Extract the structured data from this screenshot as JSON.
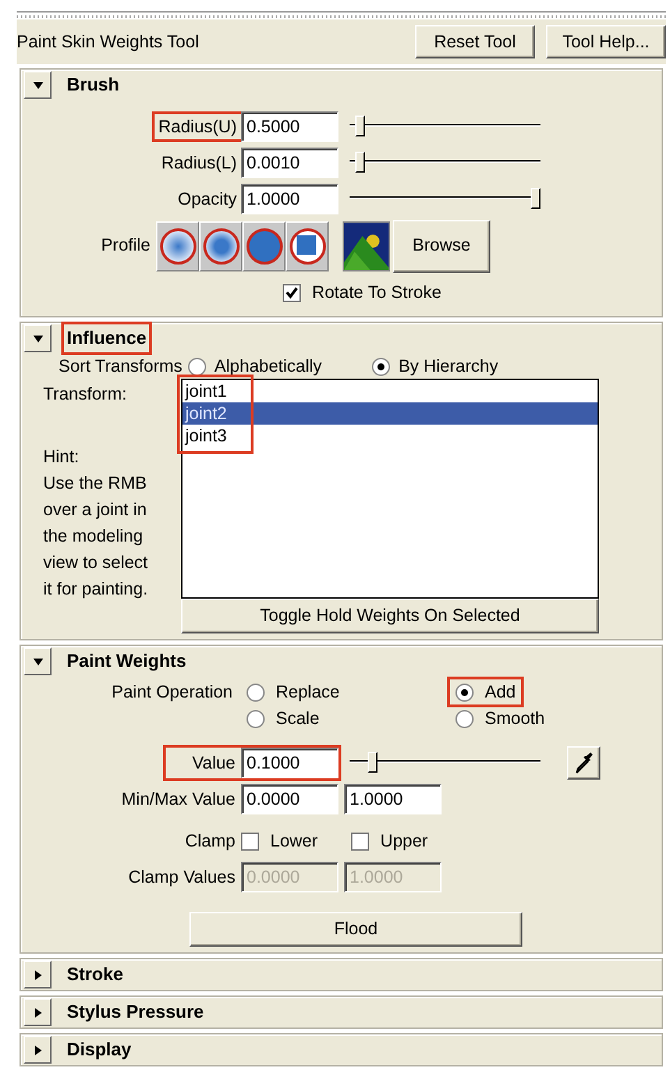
{
  "header": {
    "title": "Paint Skin Weights Tool",
    "buttons": [
      "Reset Tool",
      "Tool Help..."
    ]
  },
  "sections": [
    {
      "kind": "brush",
      "title": "Brush",
      "expanded": true,
      "highlighted": false,
      "sliders": [
        {
          "label": "Radius(U)",
          "value": "0.5000",
          "level": 0.03,
          "highlighted": true
        },
        {
          "label": "Radius(L)",
          "value": "0.0010",
          "level": 0.03,
          "highlighted": false
        },
        {
          "label": "Opacity",
          "value": "1.0000",
          "level": 1,
          "highlighted": false
        }
      ],
      "profile": {
        "label": "Profile",
        "browse": "Browse"
      },
      "rotate": {
        "label": "Rotate To Stroke",
        "checked": true
      }
    },
    {
      "kind": "influence",
      "title": "Influence",
      "expanded": true,
      "highlighted": true,
      "sort": {
        "label": "Sort Transforms",
        "options": [
          {
            "label": "Alphabetically",
            "selected": false
          },
          {
            "label": "By Hierarchy",
            "selected": true
          }
        ]
      },
      "transform_label": "Transform:",
      "hint_label": "Hint:",
      "hint": "Use the RMB over a joint in the modeling view to select it for painting.",
      "joints": [
        {
          "label": "joint1",
          "selected": false
        },
        {
          "label": "joint2",
          "selected": true
        },
        {
          "label": "joint3",
          "selected": false
        }
      ],
      "joints_highlighted": true,
      "button": "Toggle Hold Weights On Selected"
    },
    {
      "kind": "paint_weights",
      "title": "Paint Weights",
      "expanded": true,
      "highlighted": false,
      "operation": {
        "label": "Paint Operation",
        "options": [
          {
            "label": "Replace",
            "selected": false,
            "highlighted": false
          },
          {
            "label": "Add",
            "selected": true,
            "highlighted": true
          },
          {
            "label": "Scale",
            "selected": false,
            "highlighted": false
          },
          {
            "label": "Smooth",
            "selected": false,
            "highlighted": false
          }
        ]
      },
      "value": {
        "label": "Value",
        "value": "0.1000",
        "level": 0.1,
        "highlighted": true
      },
      "minmax": {
        "label": "Min/Max Value",
        "values": [
          "0.0000",
          "1.0000"
        ],
        "disabled": false
      },
      "clamp": {
        "label": "Clamp",
        "options": [
          {
            "label": "Lower",
            "checked": false
          },
          {
            "label": "Upper",
            "checked": false
          }
        ]
      },
      "clamp_values": {
        "label": "Clamp Values",
        "values": [
          "0.0000",
          "1.0000"
        ],
        "disabled": true
      },
      "button": "Flood"
    },
    {
      "title": "Stroke",
      "expanded": false,
      "highlighted": false
    },
    {
      "title": "Stylus Pressure",
      "expanded": false,
      "highlighted": false
    },
    {
      "title": "Display",
      "expanded": false,
      "highlighted": false
    }
  ]
}
